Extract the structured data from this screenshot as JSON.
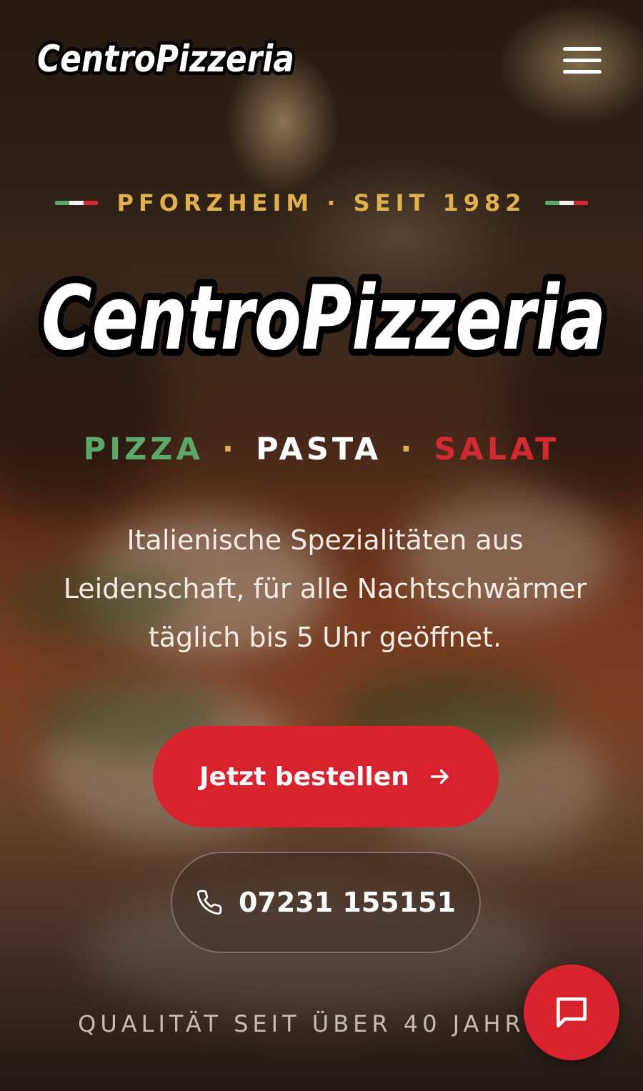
{
  "header": {
    "logo_text": "CentroPizzeria",
    "menu_icon": "hamburger-menu-icon"
  },
  "hero": {
    "kicker": "PFORZHEIM · SEIT 1982",
    "logo_text": "CentroPizzeria",
    "tagline": {
      "pizza": "PIZZA",
      "separator": "·",
      "pasta": "PASTA",
      "salat": "SALAT"
    },
    "description_lines": [
      "Italienische Spezialitäten aus",
      "Leidenschaft, für alle Nachtschwärmer",
      "täglich bis 5 Uhr geöffnet."
    ],
    "order_button": {
      "label": "Jetzt bestellen",
      "icon": "arrow-right-icon"
    },
    "phone_button": {
      "label": "07231 155151",
      "icon": "phone-icon"
    },
    "quality_text": "QUALITÄT SEIT ÜBER 40 JAHREN"
  },
  "chat": {
    "icon": "chat-bubble-icon"
  },
  "colors": {
    "accent_red": "#d8232f",
    "gold": "#e0b04e",
    "italy_green": "#5aa86a",
    "italy_red": "#d12a33"
  }
}
